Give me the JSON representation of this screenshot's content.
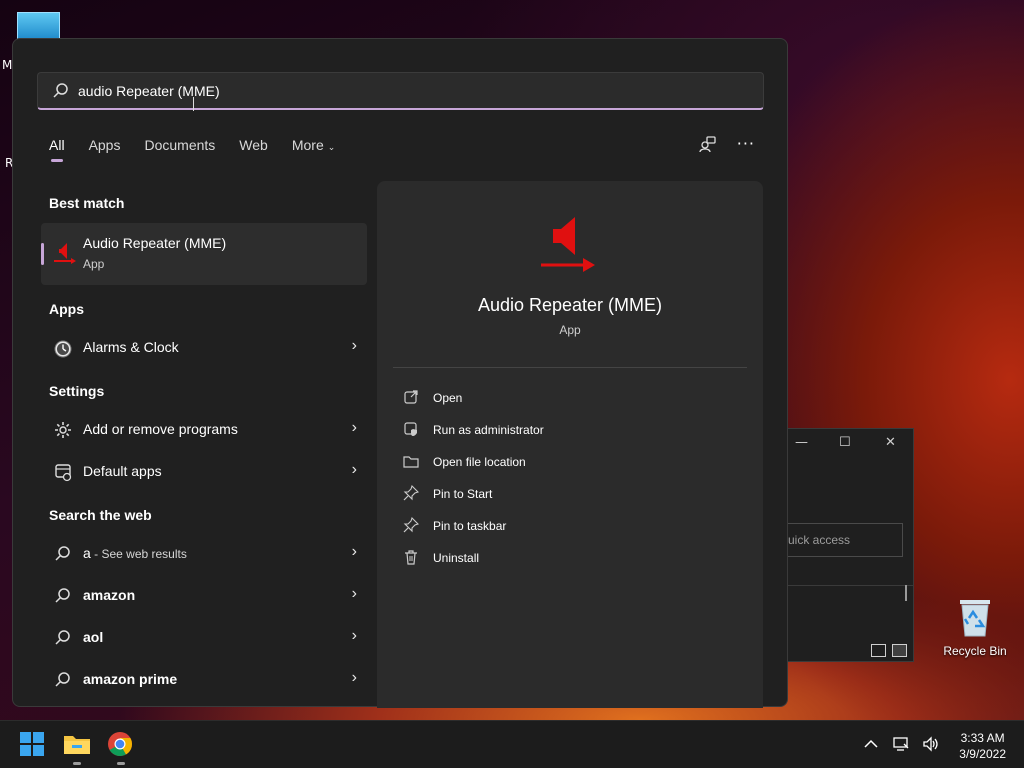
{
  "desktop": {
    "letters": [
      "M",
      "R"
    ],
    "recycle_label": "Recycle Bin"
  },
  "background_window": {
    "quick_access_placeholder": "uick access"
  },
  "search": {
    "value": "audio Repeater (MME)"
  },
  "tabs": [
    {
      "label": "All"
    },
    {
      "label": "Apps"
    },
    {
      "label": "Documents"
    },
    {
      "label": "Web"
    },
    {
      "label": "More"
    }
  ],
  "best_match": {
    "heading": "Best match",
    "name": "Audio Repeater (MME)",
    "type": "App"
  },
  "apps": {
    "heading": "Apps",
    "items": [
      {
        "label": "Alarms & Clock"
      }
    ]
  },
  "settings": {
    "heading": "Settings",
    "items": [
      {
        "label": "Add or remove programs"
      },
      {
        "label": "Default apps"
      }
    ]
  },
  "web": {
    "heading": "Search the web",
    "items": [
      {
        "label": "a",
        "suffix": " - See web results"
      },
      {
        "label": "amazon"
      },
      {
        "label": "aol"
      },
      {
        "label": "amazon prime"
      }
    ]
  },
  "detail": {
    "title": "Audio Repeater (MME)",
    "type": "App",
    "actions": [
      {
        "label": "Open",
        "icon": "open-icon"
      },
      {
        "label": "Run as administrator",
        "icon": "admin-shield-icon"
      },
      {
        "label": "Open file location",
        "icon": "folder-icon"
      },
      {
        "label": "Pin to Start",
        "icon": "pin-icon"
      },
      {
        "label": "Pin to taskbar",
        "icon": "pin-icon"
      },
      {
        "label": "Uninstall",
        "icon": "trash-icon"
      }
    ]
  },
  "taskbar": {
    "time": "3:33 AM",
    "date": "3/9/2022"
  },
  "colors": {
    "accent": "#c7a6d8",
    "app_icon_red": "#e01010",
    "panel_bg": "#202020"
  }
}
